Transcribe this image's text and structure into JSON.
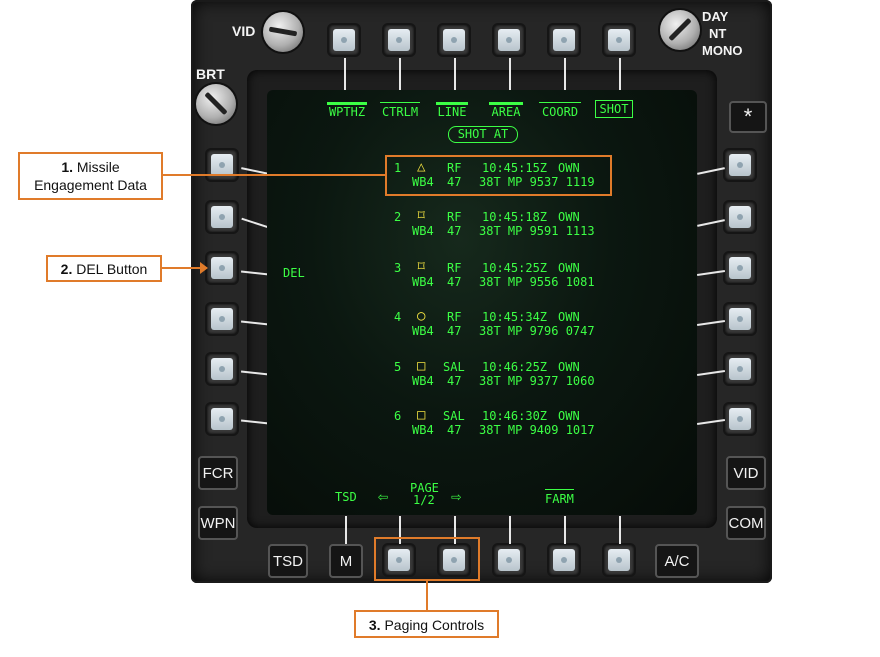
{
  "bezel": {
    "knobs": {
      "vid": "VID",
      "brt": "BRT",
      "day": "DAY",
      "nt": "NT",
      "mono": "MONO"
    },
    "star": "*",
    "left_buttons": {
      "fcr": "FCR",
      "wpn": "WPN"
    },
    "right_buttons": {
      "vid": "VID",
      "com": "COM"
    },
    "bottom_buttons": {
      "tsd": "TSD",
      "m": "M",
      "ac": "A/C"
    }
  },
  "screen": {
    "top_tabs": [
      "WPTHZ",
      "CTRLM",
      "LINE",
      "AREA",
      "COORD",
      "SHOT"
    ],
    "selected_tab": "SHOT",
    "title": "SHOT AT",
    "del_label": "DEL",
    "entries": [
      {
        "num": "1",
        "symbol": "triangle",
        "sym_char": "△",
        "mode": "RF",
        "time": "10:45:15Z",
        "owner": "OWN",
        "weapon": "WB4",
        "zone": "47",
        "grid": "38T MP 9537 1119"
      },
      {
        "num": "2",
        "symbol": "bowtie-square",
        "sym_char": "⌑",
        "mode": "RF",
        "time": "10:45:18Z",
        "owner": "OWN",
        "weapon": "WB4",
        "zone": "47",
        "grid": "38T MP 9591 1113"
      },
      {
        "num": "3",
        "symbol": "bowtie-square",
        "sym_char": "⌑",
        "mode": "RF",
        "time": "10:45:25Z",
        "owner": "OWN",
        "weapon": "WB4",
        "zone": "47",
        "grid": "38T MP 9556 1081"
      },
      {
        "num": "4",
        "symbol": "circle",
        "sym_char": "○",
        "mode": "RF",
        "time": "10:45:34Z",
        "owner": "OWN",
        "weapon": "WB4",
        "zone": "47",
        "grid": "38T MP 9796 0747"
      },
      {
        "num": "5",
        "symbol": "square",
        "sym_char": "□",
        "mode": "SAL",
        "time": "10:46:25Z",
        "owner": "OWN",
        "weapon": "WB4",
        "zone": "47",
        "grid": "38T MP 9377 1060"
      },
      {
        "num": "6",
        "symbol": "square",
        "sym_char": "□",
        "mode": "SAL",
        "time": "10:46:30Z",
        "owner": "OWN",
        "weapon": "WB4",
        "zone": "47",
        "grid": "38T MP 9409 1017"
      }
    ],
    "bottom": {
      "tsd": "TSD",
      "page_label": "PAGE",
      "page_num": "1/2",
      "farm": "FARM",
      "prev_arrow": "⇦",
      "next_arrow": "⇨"
    }
  },
  "callouts": {
    "c1_num": "1.",
    "c1_text_a": "Missile",
    "c1_text_b": "Engagement Data",
    "c2_num": "2.",
    "c2_text": "DEL Button",
    "c3_num": "3.",
    "c3_text": "Paging Controls"
  },
  "colors": {
    "symbology": "#3cff45",
    "callout": "#e07b2a",
    "symbol_yellow": "#f0e040"
  }
}
